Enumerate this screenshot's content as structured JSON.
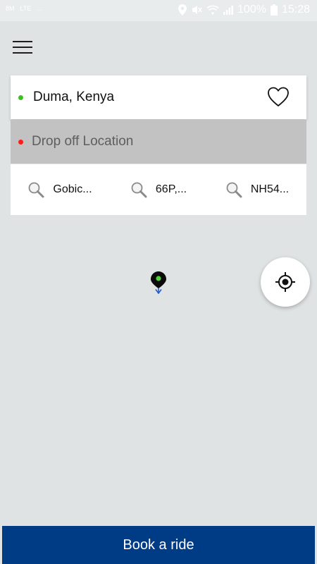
{
  "status_bar": {
    "left_items": [
      "8M",
      "LTE",
      "..."
    ],
    "battery_percent": "100%",
    "time": "15:28",
    "icons": [
      "location-icon",
      "mute-icon",
      "wifi-icon",
      "signal-icon",
      "battery-icon"
    ]
  },
  "pickup": {
    "text": "Duma, Kenya",
    "dot_color": "#3cc020",
    "favorite_icon": "heart-icon"
  },
  "dropoff": {
    "placeholder": "Drop off Location",
    "dot_color": "#ff1a1a"
  },
  "recent_searches": [
    {
      "label": "Gobic..."
    },
    {
      "label": "66P,..."
    },
    {
      "label": "NH54..."
    }
  ],
  "map": {
    "pin_icon": "map-pin-icon",
    "locate_icon": "gps-locate-icon"
  },
  "book_button": {
    "label": "Book a ride",
    "color": "#003b86"
  }
}
